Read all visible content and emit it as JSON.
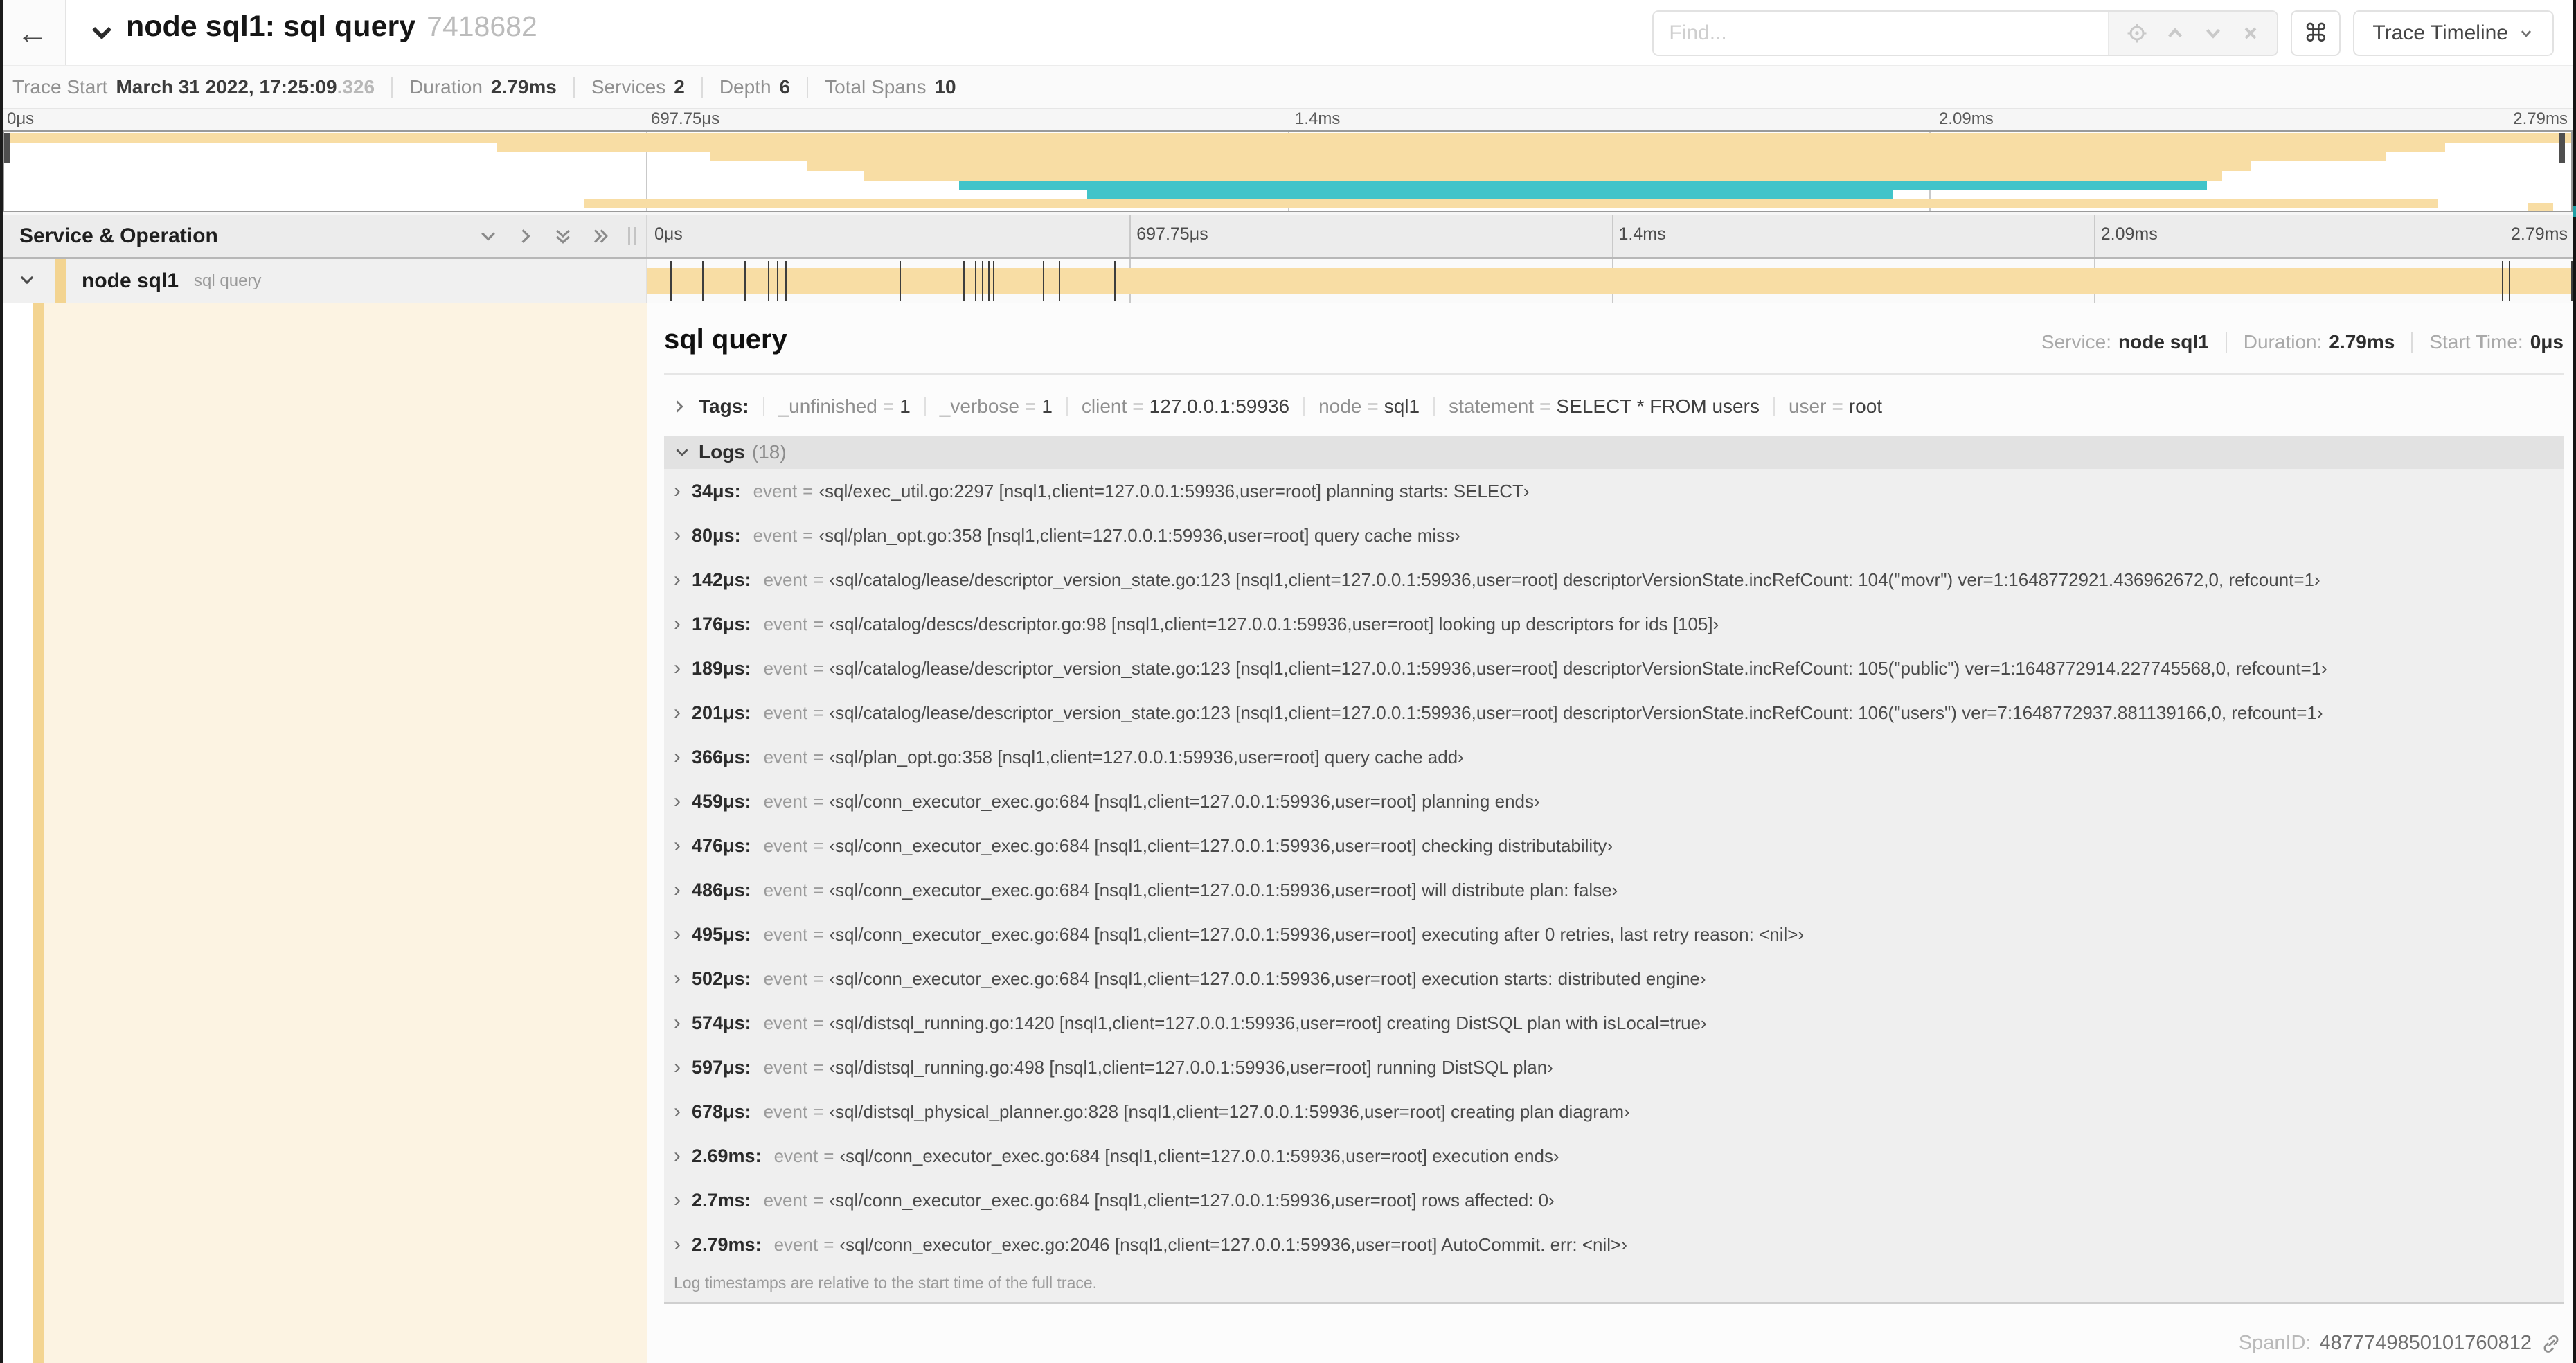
{
  "colors": {
    "span_yellow": "#f8dda4",
    "span_teal": "#41c4c9",
    "row_stripe": "#f3d491",
    "detail_cream": "#fcf3e2"
  },
  "header": {
    "title": "node sql1: sql query",
    "trace_id": "7418682",
    "find_placeholder": "Find...",
    "view_button": "Trace Timeline"
  },
  "summary": {
    "items": [
      {
        "label": "Trace Start",
        "value": "March 31 2022, 17:25:09",
        "muted": ".326"
      },
      {
        "label": "Duration",
        "value": "2.79ms"
      },
      {
        "label": "Services",
        "value": "2"
      },
      {
        "label": "Depth",
        "value": "6"
      },
      {
        "label": "Total Spans",
        "value": "10"
      }
    ]
  },
  "timeline": {
    "duration_us": 2790,
    "ticks": [
      "0μs",
      "697.75μs",
      "1.4ms",
      "2.09ms",
      "2.79ms"
    ],
    "minimap_bands": [
      {
        "t": 2,
        "h": 12,
        "s": 0,
        "e": 100,
        "c": "span_yellow"
      },
      {
        "t": 14,
        "h": 12,
        "s": 19.2,
        "e": 95.1,
        "c": "span_yellow"
      },
      {
        "t": 26,
        "h": 12,
        "s": 27.5,
        "e": 92.8,
        "c": "span_yellow"
      },
      {
        "t": 38,
        "h": 12,
        "s": 31.3,
        "e": 87.5,
        "c": "span_yellow"
      },
      {
        "t": 50,
        "h": 12,
        "s": 33.5,
        "e": 86.4,
        "c": "span_yellow"
      },
      {
        "t": 62,
        "h": 12,
        "s": 37.2,
        "e": 85.8,
        "c": "span_teal"
      },
      {
        "t": 74,
        "h": 12,
        "s": 42.2,
        "e": 73.6,
        "c": "span_teal"
      },
      {
        "t": 86,
        "h": 11,
        "s": 22.6,
        "e": 94.8,
        "c": "span_yellow"
      },
      {
        "t": 90,
        "h": 10,
        "s": 98.3,
        "e": 99.3,
        "c": "span_yellow"
      }
    ]
  },
  "left_panel": {
    "title": "Service & Operation",
    "row": {
      "service": "node sql1",
      "operation": "sql query"
    }
  },
  "detail": {
    "title": "sql query",
    "meta": [
      {
        "label": "Service:",
        "value": "node sql1"
      },
      {
        "label": "Duration:",
        "value": "2.79ms"
      },
      {
        "label": "Start Time:",
        "value": "0μs"
      }
    ],
    "tags_label": "Tags:",
    "tags": [
      {
        "key": "_unfinished",
        "value": "1"
      },
      {
        "key": "_verbose",
        "value": "1"
      },
      {
        "key": "client",
        "value": "127.0.0.1:59936"
      },
      {
        "key": "node",
        "value": "sql1"
      },
      {
        "key": "statement",
        "value": "SELECT * FROM users"
      },
      {
        "key": "user",
        "value": "root"
      }
    ],
    "logs_label": "Logs",
    "logs_count": "(18)",
    "logs": [
      {
        "time": "34μs",
        "t_us": 34,
        "field": "event",
        "value": "‹sql/exec_util.go:2297 [nsql1,client=127.0.0.1:59936,user=root] planning starts: SELECT›"
      },
      {
        "time": "80μs",
        "t_us": 80,
        "field": "event",
        "value": "‹sql/plan_opt.go:358 [nsql1,client=127.0.0.1:59936,user=root] query cache miss›"
      },
      {
        "time": "142μs",
        "t_us": 142,
        "field": "event",
        "value": "‹sql/catalog/lease/descriptor_version_state.go:123 [nsql1,client=127.0.0.1:59936,user=root] descriptorVersionState.incRefCount: 104(\"movr\") ver=1:1648772921.436962672,0, refcount=1›"
      },
      {
        "time": "176μs",
        "t_us": 176,
        "field": "event",
        "value": "‹sql/catalog/descs/descriptor.go:98 [nsql1,client=127.0.0.1:59936,user=root] looking up descriptors for ids [105]›"
      },
      {
        "time": "189μs",
        "t_us": 189,
        "field": "event",
        "value": "‹sql/catalog/lease/descriptor_version_state.go:123 [nsql1,client=127.0.0.1:59936,user=root] descriptorVersionState.incRefCount: 105(\"public\") ver=1:1648772914.227745568,0, refcount=1›"
      },
      {
        "time": "201μs",
        "t_us": 201,
        "field": "event",
        "value": "‹sql/catalog/lease/descriptor_version_state.go:123 [nsql1,client=127.0.0.1:59936,user=root] descriptorVersionState.incRefCount: 106(\"users\") ver=7:1648772937.881139166,0, refcount=1›"
      },
      {
        "time": "366μs",
        "t_us": 366,
        "field": "event",
        "value": "‹sql/plan_opt.go:358 [nsql1,client=127.0.0.1:59936,user=root] query cache add›"
      },
      {
        "time": "459μs",
        "t_us": 459,
        "field": "event",
        "value": "‹sql/conn_executor_exec.go:684 [nsql1,client=127.0.0.1:59936,user=root] planning ends›"
      },
      {
        "time": "476μs",
        "t_us": 476,
        "field": "event",
        "value": "‹sql/conn_executor_exec.go:684 [nsql1,client=127.0.0.1:59936,user=root] checking distributability›"
      },
      {
        "time": "486μs",
        "t_us": 486,
        "field": "event",
        "value": "‹sql/conn_executor_exec.go:684 [nsql1,client=127.0.0.1:59936,user=root] will distribute plan: false›"
      },
      {
        "time": "495μs",
        "t_us": 495,
        "field": "event",
        "value": "‹sql/conn_executor_exec.go:684 [nsql1,client=127.0.0.1:59936,user=root] executing after 0 retries, last retry reason: <nil>›"
      },
      {
        "time": "502μs",
        "t_us": 502,
        "field": "event",
        "value": "‹sql/conn_executor_exec.go:684 [nsql1,client=127.0.0.1:59936,user=root] execution starts: distributed engine›"
      },
      {
        "time": "574μs",
        "t_us": 574,
        "field": "event",
        "value": "‹sql/distsql_running.go:1420 [nsql1,client=127.0.0.1:59936,user=root] creating DistSQL plan with isLocal=true›"
      },
      {
        "time": "597μs",
        "t_us": 597,
        "field": "event",
        "value": "‹sql/distsql_running.go:498 [nsql1,client=127.0.0.1:59936,user=root] running DistSQL plan›"
      },
      {
        "time": "678μs",
        "t_us": 678,
        "field": "event",
        "value": "‹sql/distsql_physical_planner.go:828 [nsql1,client=127.0.0.1:59936,user=root] creating plan diagram›"
      },
      {
        "time": "2.69ms",
        "t_us": 2690,
        "field": "event",
        "value": "‹sql/conn_executor_exec.go:684 [nsql1,client=127.0.0.1:59936,user=root] execution ends›"
      },
      {
        "time": "2.7ms",
        "t_us": 2700,
        "field": "event",
        "value": "‹sql/conn_executor_exec.go:684 [nsql1,client=127.0.0.1:59936,user=root] rows affected: 0›"
      },
      {
        "time": "2.79ms",
        "t_us": 2790,
        "field": "event",
        "value": "‹sql/conn_executor_exec.go:2046 [nsql1,client=127.0.0.1:59936,user=root] AutoCommit. err: <nil>›"
      }
    ],
    "logs_note": "Log timestamps are relative to the start time of the full trace.",
    "span_id_label": "SpanID:",
    "span_id": "4877749850101760812"
  }
}
